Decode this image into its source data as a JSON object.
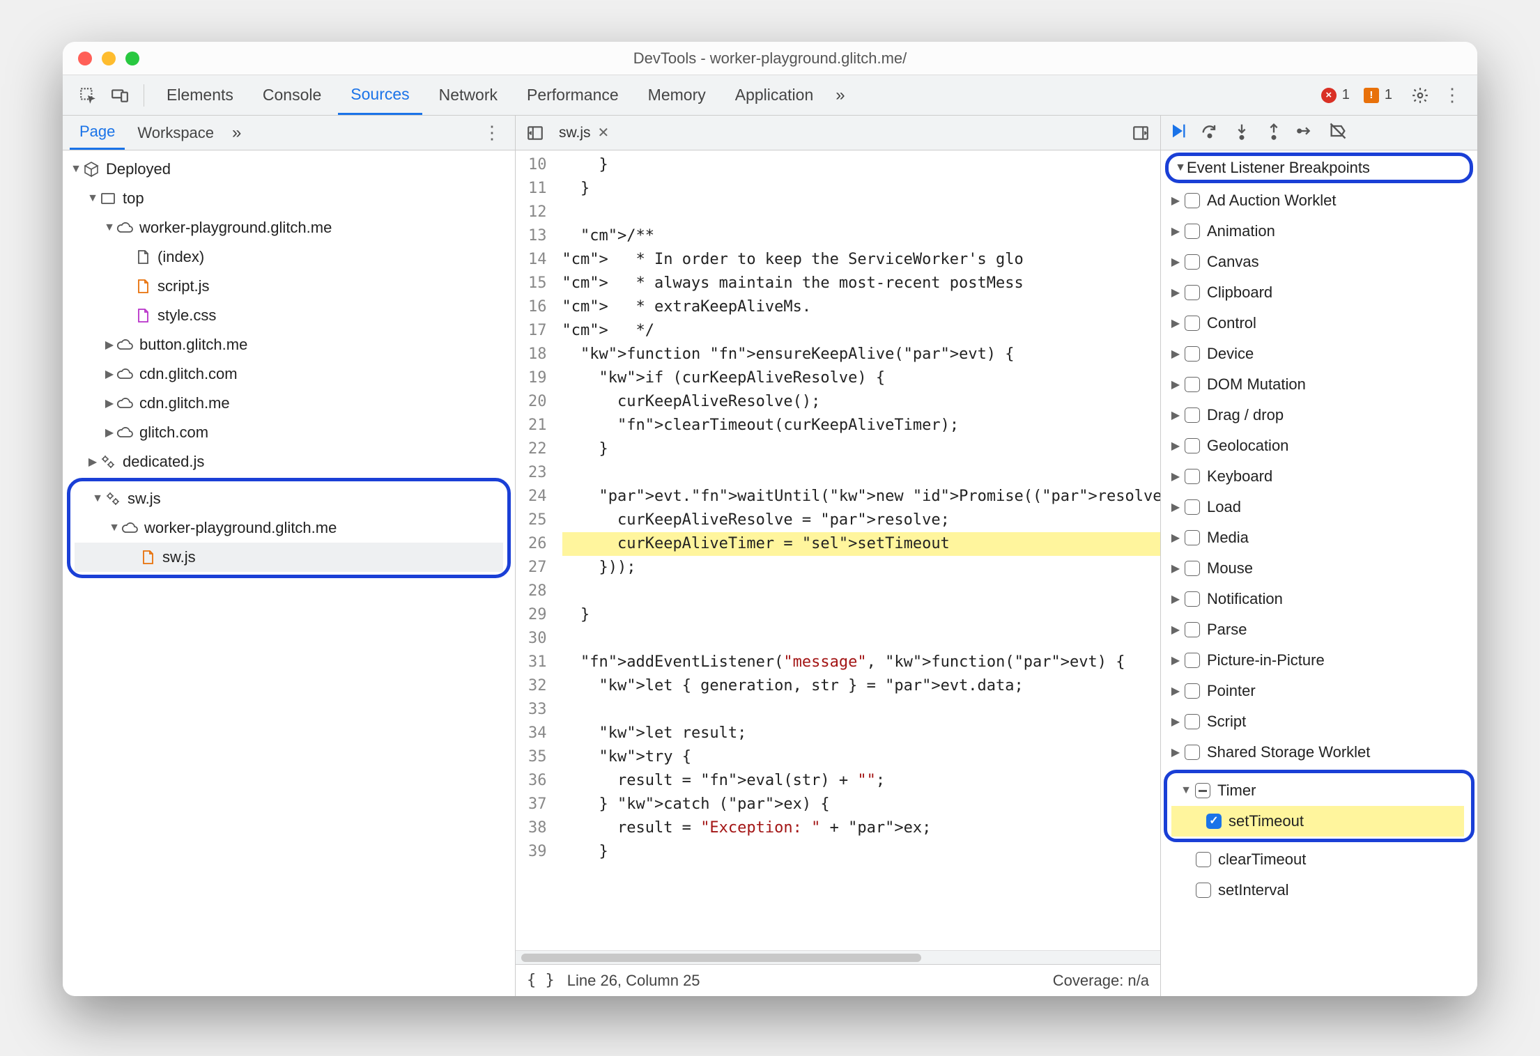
{
  "title": "DevTools - worker-playground.glitch.me/",
  "errors": 1,
  "warnings": 1,
  "tabs": [
    "Elements",
    "Console",
    "Sources",
    "Network",
    "Performance",
    "Memory",
    "Application"
  ],
  "activeTab": "Sources",
  "leftTabs": {
    "active": "Page",
    "other": "Workspace"
  },
  "tree": {
    "root": "Deployed",
    "top": "top",
    "domain": "worker-playground.glitch.me",
    "files": {
      "index": "(index)",
      "script": "script.js",
      "style": "style.css"
    },
    "clouds": [
      "button.glitch.me",
      "cdn.glitch.com",
      "cdn.glitch.me",
      "glitch.com"
    ],
    "dedicated": "dedicated.js",
    "sw": "sw.js",
    "swDomain": "worker-playground.glitch.me",
    "swFile": "sw.js"
  },
  "editor": {
    "filename": "sw.js",
    "startLine": 10,
    "endLine": 39,
    "statusLine": "Line 26, Column 25",
    "coverage": "Coverage: n/a",
    "lines": [
      "    }",
      "  }",
      "",
      "  /**",
      "   * In order to keep the ServiceWorker's glo",
      "   * always maintain the most-recent postMess",
      "   * extraKeepAliveMs.",
      "   */",
      "  function ensureKeepAlive(evt) {",
      "    if (curKeepAliveResolve) {",
      "      curKeepAliveResolve();",
      "      clearTimeout(curKeepAliveTimer);",
      "    }",
      "",
      "    evt.waitUntil(new Promise((resolve) => {",
      "      curKeepAliveResolve = resolve;",
      "      curKeepAliveTimer = setTimeout(keepAliv",
      "    }));",
      "",
      "  }",
      "",
      "  addEventListener(\"message\", function(evt) {",
      "    let { generation, str } = evt.data;",
      "",
      "    let result;",
      "    try {",
      "      result = eval(str) + \"\";",
      "    } catch (ex) {",
      "      result = \"Exception: \" + ex;",
      "    }"
    ]
  },
  "breakpoints": {
    "header": "Event Listener Breakpoints",
    "categories": [
      "Ad Auction Worklet",
      "Animation",
      "Canvas",
      "Clipboard",
      "Control",
      "Device",
      "DOM Mutation",
      "Drag / drop",
      "Geolocation",
      "Keyboard",
      "Load",
      "Media",
      "Mouse",
      "Notification",
      "Parse",
      "Picture-in-Picture",
      "Pointer",
      "Script",
      "Shared Storage Worklet"
    ],
    "timer": {
      "label": "Timer",
      "items": [
        "setTimeout",
        "clearTimeout",
        "setInterval"
      ],
      "checked": "setTimeout"
    }
  }
}
